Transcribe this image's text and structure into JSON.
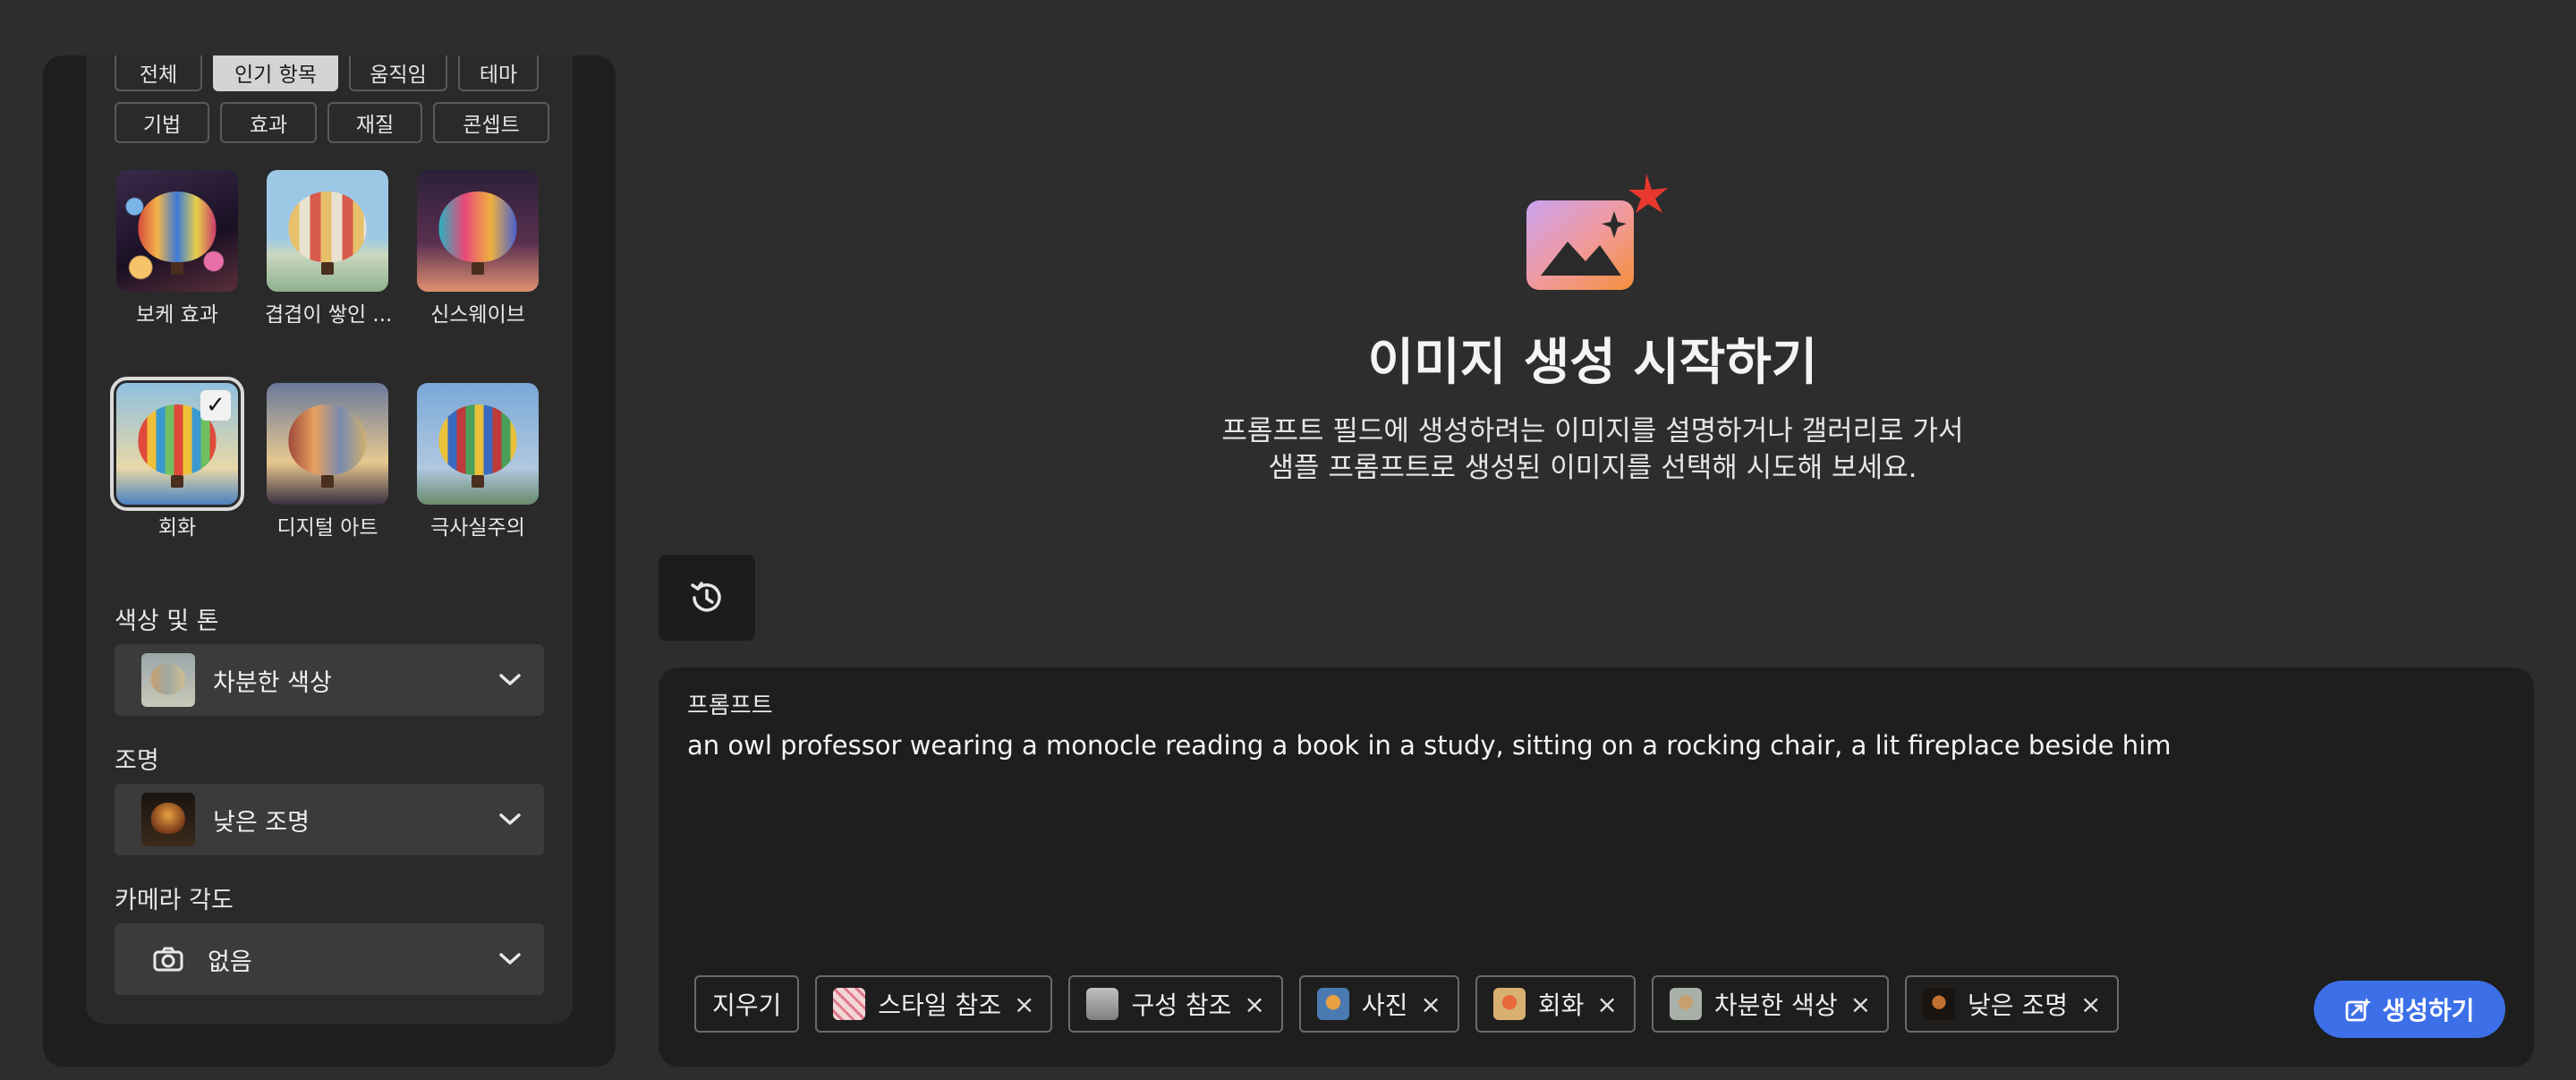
{
  "colors": {
    "accent": "#3c6fe8",
    "background": "#2d2d2d",
    "panel": "#1e1e1e"
  },
  "left_panel": {
    "tabs_row1": [
      "전체",
      "인기 항목",
      "움직임",
      "테마"
    ],
    "active_tab": "인기 항목",
    "tabs_row2": [
      "기법",
      "효과",
      "재질",
      "콘셉트"
    ],
    "styles": [
      {
        "label": "보케 효과",
        "selected": false
      },
      {
        "label": "겹겹이 쌓인 ...",
        "selected": false
      },
      {
        "label": "신스웨이브",
        "selected": false
      },
      {
        "label": "회화",
        "selected": true
      },
      {
        "label": "디지털 아트",
        "selected": false
      },
      {
        "label": "극사실주의",
        "selected": false
      }
    ],
    "color_tone": {
      "label": "색상 및 톤",
      "value": "차분한 색상"
    },
    "lighting": {
      "label": "조명",
      "value": "낮은 조명"
    },
    "camera_angle": {
      "label": "카메라 각도",
      "value": "없음",
      "icon": "camera-icon"
    }
  },
  "hero": {
    "icon": "image-sparkle-icon",
    "title": "이미지 생성 시작하기",
    "description": "프롬프트 필드에 생성하려는 이미지를 설명하거나 갤러리로 가서 샘플 프롬프트로 생성된 이미지를 선택해 시도해 보세요."
  },
  "history_icon": "history-icon",
  "prompt": {
    "label": "프롬프트",
    "text": "an owl professor wearing a monocle reading a book in a study, sitting on a rocking chair, a lit fireplace beside him",
    "clear_label": "지우기",
    "tags": [
      "스타일 참조",
      "구성 참조",
      "사진",
      "회화",
      "차분한 색상",
      "낮은 조명"
    ],
    "generate_label": "생성하기"
  }
}
